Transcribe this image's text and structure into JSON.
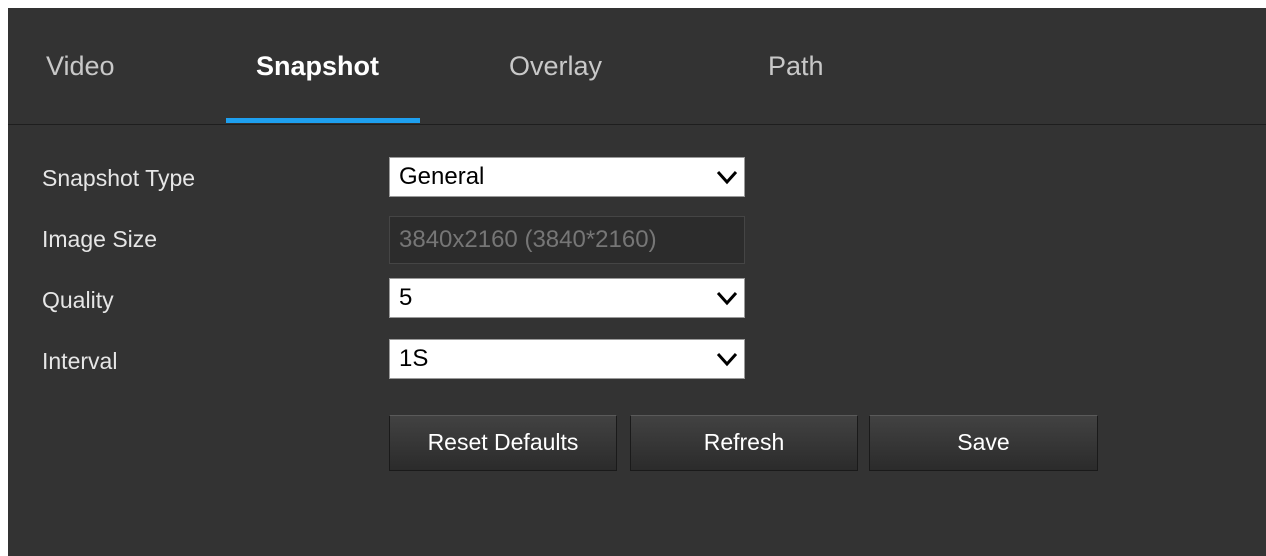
{
  "tabs": [
    {
      "label": "Video",
      "active": false
    },
    {
      "label": "Snapshot",
      "active": true
    },
    {
      "label": "Overlay",
      "active": false
    },
    {
      "label": "Path",
      "active": false
    }
  ],
  "form": {
    "snapshot_type": {
      "label": "Snapshot Type",
      "value": "General"
    },
    "image_size": {
      "label": "Image Size",
      "value": "3840x2160 (3840*2160)",
      "disabled": true
    },
    "quality": {
      "label": "Quality",
      "value": "5"
    },
    "interval": {
      "label": "Interval",
      "value": "1S"
    }
  },
  "buttons": {
    "reset_defaults": "Reset Defaults",
    "refresh": "Refresh",
    "save": "Save"
  },
  "colors": {
    "panel_background": "#333333",
    "active_tab_indicator": "#1ea0f0",
    "input_background": "#ffffff"
  },
  "icons": {
    "dropdown": "chevron-down-icon"
  }
}
